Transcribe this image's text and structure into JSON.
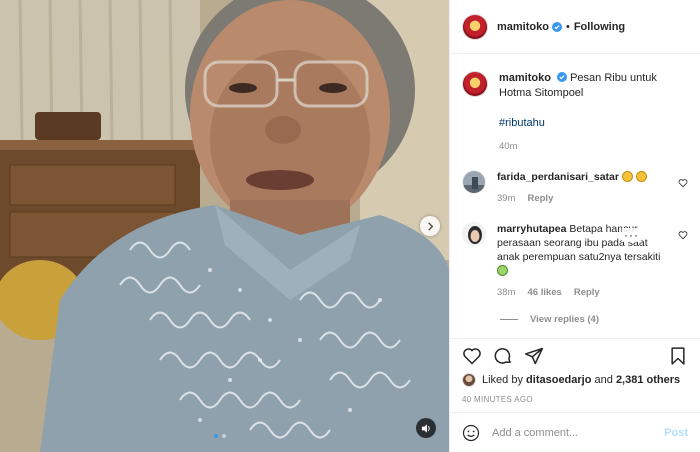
{
  "post": {
    "username": "mamitoko",
    "follow_status": "Following",
    "separator": "•"
  },
  "caption": {
    "username": "mamitoko",
    "text": "Pesan Ribu untuk Hotma Sitompoel",
    "hashtag": "#ributahu",
    "time": "40m"
  },
  "comments": [
    {
      "username": "farida_perdanisari_satar",
      "text": "",
      "time": "39m",
      "reply": "Reply"
    },
    {
      "username": "marryhutapea",
      "text": "Betapa hancur perasaan seorang ibu pada saat anak perempuan satu2nya tersakiti",
      "time": "38m",
      "likes": "46 likes",
      "reply": "Reply",
      "more": "···",
      "view_replies": "View replies (4)"
    }
  ],
  "likes": {
    "prefix": "Liked by",
    "user": "ditasoedarjo",
    "and": "and",
    "others": "2,381 others"
  },
  "timestamp": "40 MINUTES AGO",
  "add_comment": {
    "placeholder": "Add a comment...",
    "post_label": "Post"
  },
  "icons": {
    "like": "heart-icon",
    "comment": "comment-icon",
    "share": "share-icon",
    "save": "bookmark-icon",
    "emoji": "smiley-icon",
    "verified": "verified-badge-icon",
    "next": "chevron-right-icon",
    "sound": "speaker-icon"
  },
  "colors": {
    "accent": "#3897f0",
    "link": "#00376b",
    "muted": "#8e8e8e",
    "post_disabled": "#b2dffc"
  }
}
